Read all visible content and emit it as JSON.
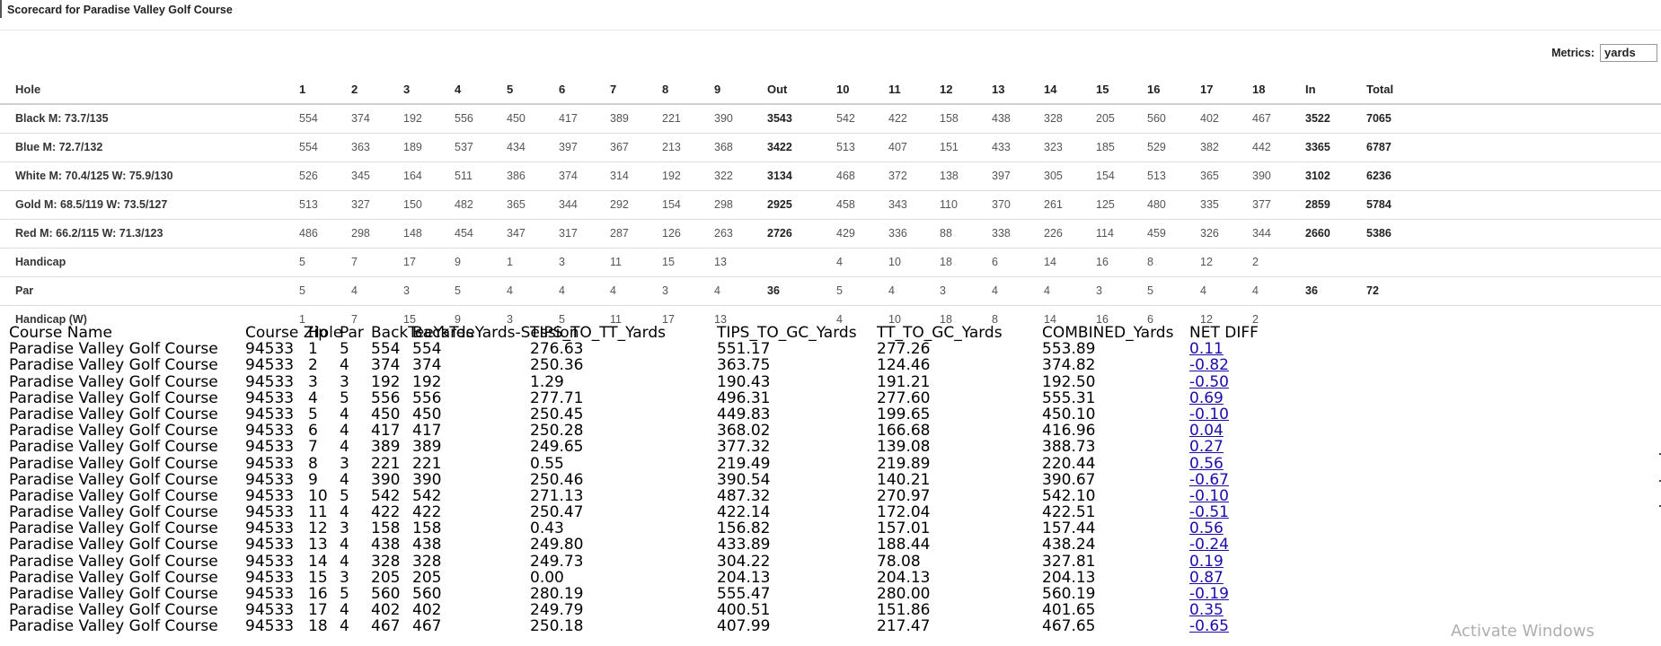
{
  "title": "Scorecard for Paradise Valley Golf Course",
  "metrics": {
    "label": "Metrics:",
    "selected": "yards"
  },
  "scorecard": {
    "header": {
      "label": "Hole",
      "cols": [
        "1",
        "2",
        "3",
        "4",
        "5",
        "6",
        "7",
        "8",
        "9",
        "Out",
        "10",
        "11",
        "12",
        "13",
        "14",
        "15",
        "16",
        "17",
        "18",
        "In",
        "Total"
      ]
    },
    "rows": [
      {
        "label": "Black M: 73.7/135",
        "cols": [
          "554",
          "374",
          "192",
          "556",
          "450",
          "417",
          "389",
          "221",
          "390",
          "3543",
          "542",
          "422",
          "158",
          "438",
          "328",
          "205",
          "560",
          "402",
          "467",
          "3522",
          "7065"
        ]
      },
      {
        "label": "Blue M: 72.7/132",
        "cols": [
          "554",
          "363",
          "189",
          "537",
          "434",
          "397",
          "367",
          "213",
          "368",
          "3422",
          "513",
          "407",
          "151",
          "433",
          "323",
          "185",
          "529",
          "382",
          "442",
          "3365",
          "6787"
        ]
      },
      {
        "label": "White M: 70.4/125 W: 75.9/130",
        "cols": [
          "526",
          "345",
          "164",
          "511",
          "386",
          "374",
          "314",
          "192",
          "322",
          "3134",
          "468",
          "372",
          "138",
          "397",
          "305",
          "154",
          "513",
          "365",
          "390",
          "3102",
          "6236"
        ]
      },
      {
        "label": "Gold M: 68.5/119 W: 73.5/127",
        "cols": [
          "513",
          "327",
          "150",
          "482",
          "365",
          "344",
          "292",
          "154",
          "298",
          "2925",
          "458",
          "343",
          "110",
          "370",
          "261",
          "125",
          "480",
          "335",
          "377",
          "2859",
          "5784"
        ]
      },
      {
        "label": "Red M: 66.2/115 W: 71.3/123",
        "cols": [
          "486",
          "298",
          "148",
          "454",
          "347",
          "317",
          "287",
          "126",
          "263",
          "2726",
          "429",
          "336",
          "88",
          "338",
          "226",
          "114",
          "459",
          "326",
          "344",
          "2660",
          "5386"
        ]
      },
      {
        "label": "Handicap",
        "cols": [
          "5",
          "7",
          "17",
          "9",
          "1",
          "3",
          "11",
          "15",
          "13",
          "",
          "4",
          "10",
          "18",
          "6",
          "14",
          "16",
          "8",
          "12",
          "2",
          "",
          ""
        ]
      },
      {
        "label": "Par",
        "cols": [
          "5",
          "4",
          "3",
          "5",
          "4",
          "4",
          "4",
          "3",
          "4",
          "36",
          "5",
          "4",
          "3",
          "4",
          "4",
          "3",
          "5",
          "4",
          "4",
          "36",
          "72"
        ]
      },
      {
        "label": "Handicap (W)",
        "cols": [
          "1",
          "7",
          "15",
          "9",
          "3",
          "5",
          "11",
          "17",
          "13",
          "",
          "4",
          "10",
          "18",
          "8",
          "14",
          "16",
          "6",
          "12",
          "2",
          "",
          ""
        ]
      }
    ]
  },
  "scores": {
    "headers": [
      "Course Name",
      "Course Zip",
      "Hole",
      "Par",
      "BackTeeYards",
      "BackTeeYards-Session",
      "TIPS_TO_TT_Yards",
      "TIPS_TO_GC_Yards",
      "TT_TO_GC_Yards",
      "COMBINED_Yards",
      "NET DIFF"
    ],
    "rows": [
      [
        "Paradise Valley Golf Course",
        "94533",
        "1",
        "5",
        "554",
        "554",
        "276.63",
        "551.17",
        "277.26",
        "553.89",
        "0.11"
      ],
      [
        "Paradise Valley Golf Course",
        "94533",
        "2",
        "4",
        "374",
        "374",
        "250.36",
        "363.75",
        "124.46",
        "374.82",
        "-0.82"
      ],
      [
        "Paradise Valley Golf Course",
        "94533",
        "3",
        "3",
        "192",
        "192",
        "1.29",
        "190.43",
        "191.21",
        "192.50",
        "-0.50"
      ],
      [
        "Paradise Valley Golf Course",
        "94533",
        "4",
        "5",
        "556",
        "556",
        "277.71",
        "496.31",
        "277.60",
        "555.31",
        "0.69"
      ],
      [
        "Paradise Valley Golf Course",
        "94533",
        "5",
        "4",
        "450",
        "450",
        "250.45",
        "449.83",
        "199.65",
        "450.10",
        "-0.10"
      ],
      [
        "Paradise Valley Golf Course",
        "94533",
        "6",
        "4",
        "417",
        "417",
        "250.28",
        "368.02",
        "166.68",
        "416.96",
        "0.04"
      ],
      [
        "Paradise Valley Golf Course",
        "94533",
        "7",
        "4",
        "389",
        "389",
        "249.65",
        "377.32",
        "139.08",
        "388.73",
        "0.27"
      ],
      [
        "Paradise Valley Golf Course",
        "94533",
        "8",
        "3",
        "221",
        "221",
        "0.55",
        "219.49",
        "219.89",
        "220.44",
        "0.56"
      ],
      [
        "Paradise Valley Golf Course",
        "94533",
        "9",
        "4",
        "390",
        "390",
        "250.46",
        "390.54",
        "140.21",
        "390.67",
        "-0.67"
      ],
      [
        "Paradise Valley Golf Course",
        "94533",
        "10",
        "5",
        "542",
        "542",
        "271.13",
        "487.32",
        "270.97",
        "542.10",
        "-0.10"
      ],
      [
        "Paradise Valley Golf Course",
        "94533",
        "11",
        "4",
        "422",
        "422",
        "250.47",
        "422.14",
        "172.04",
        "422.51",
        "-0.51"
      ],
      [
        "Paradise Valley Golf Course",
        "94533",
        "12",
        "3",
        "158",
        "158",
        "0.43",
        "156.82",
        "157.01",
        "157.44",
        "0.56"
      ],
      [
        "Paradise Valley Golf Course",
        "94533",
        "13",
        "4",
        "438",
        "438",
        "249.80",
        "433.89",
        "188.44",
        "438.24",
        "-0.24"
      ],
      [
        "Paradise Valley Golf Course",
        "94533",
        "14",
        "4",
        "328",
        "328",
        "249.73",
        "304.22",
        "78.08",
        "327.81",
        "0.19"
      ],
      [
        "Paradise Valley Golf Course",
        "94533",
        "15",
        "3",
        "205",
        "205",
        "0.00",
        "204.13",
        "204.13",
        "204.13",
        "0.87"
      ],
      [
        "Paradise Valley Golf Course",
        "94533",
        "16",
        "5",
        "560",
        "560",
        "280.19",
        "555.47",
        "280.00",
        "560.19",
        "-0.19"
      ],
      [
        "Paradise Valley Golf Course",
        "94533",
        "17",
        "4",
        "402",
        "402",
        "249.79",
        "400.51",
        "151.86",
        "401.65",
        "0.35"
      ],
      [
        "Paradise Valley Golf Course",
        "94533",
        "18",
        "4",
        "467",
        "467",
        "250.18",
        "407.99",
        "217.47",
        "467.65",
        "-0.65"
      ]
    ]
  },
  "watermark": "Activate Windows"
}
